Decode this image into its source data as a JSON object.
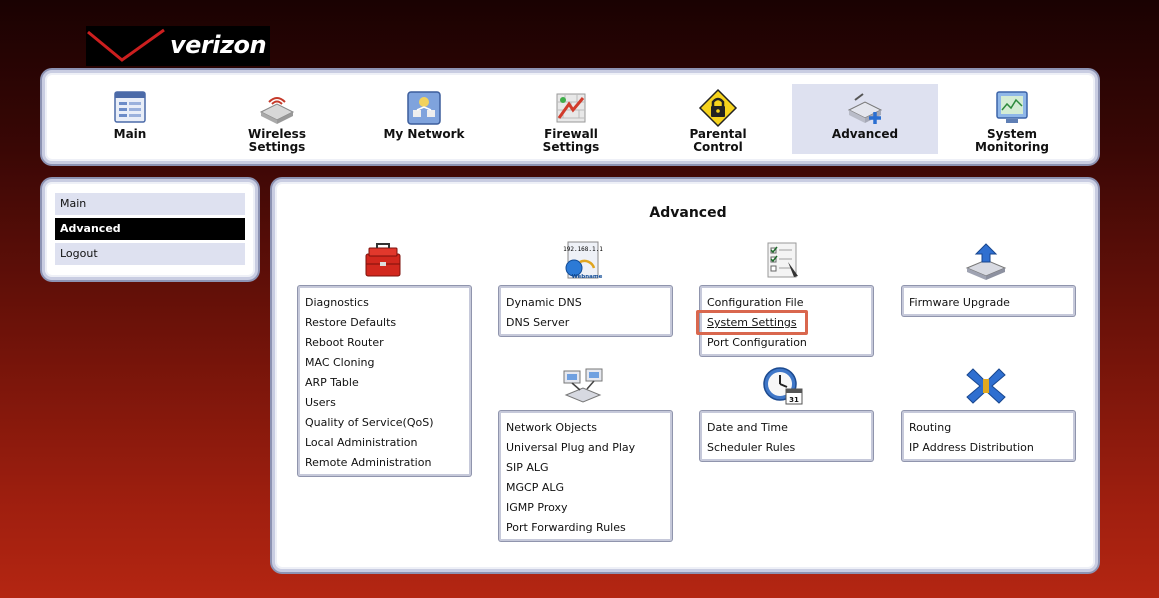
{
  "brand": {
    "name": "verizon",
    "accent_color": "#cc1f1f"
  },
  "topnav": {
    "items": [
      {
        "label": "Main",
        "icon": "main-icon"
      },
      {
        "label": "Wireless\nSettings",
        "icon": "wireless-router-icon"
      },
      {
        "label": "My Network",
        "icon": "my-network-icon"
      },
      {
        "label": "Firewall\nSettings",
        "icon": "firewall-icon"
      },
      {
        "label": "Parental\nControl",
        "icon": "parental-lock-icon"
      },
      {
        "label": "Advanced",
        "icon": "advanced-icon",
        "active": true
      },
      {
        "label": "System\nMonitoring",
        "icon": "system-monitoring-icon"
      }
    ]
  },
  "sidebar": {
    "items": [
      {
        "label": "Main"
      },
      {
        "label": "Advanced",
        "active": true
      },
      {
        "label": "Logout"
      }
    ]
  },
  "content": {
    "title": "Advanced",
    "groups": [
      {
        "icon": "toolbox-icon",
        "links": [
          "Diagnostics",
          "Restore Defaults",
          "Reboot Router",
          "MAC Cloning",
          "ARP Table",
          "Users",
          "Quality of Service(QoS)",
          "Local Administration",
          "Remote Administration"
        ]
      },
      {
        "icon": "dns-webname-icon",
        "icon_text": [
          "192.168.1.1",
          "Webname"
        ],
        "links": [
          "Dynamic DNS",
          "DNS Server"
        ]
      },
      {
        "icon": "configuration-checklist-icon",
        "links": [
          "Configuration File",
          "System Settings",
          "Port Configuration"
        ],
        "selected_index": 1
      },
      {
        "icon": "firmware-upgrade-icon",
        "links": [
          "Firmware Upgrade"
        ]
      },
      {
        "icon": "network-objects-icon",
        "links": [
          "Network Objects",
          "Universal Plug and Play",
          "SIP ALG",
          "MGCP ALG",
          "IGMP Proxy",
          "Port Forwarding Rules"
        ]
      },
      {
        "icon": "clock-calendar-icon",
        "icon_text": [
          "31"
        ],
        "links": [
          "Date and Time",
          "Scheduler Rules"
        ]
      },
      {
        "icon": "routing-icon",
        "links": [
          "Routing",
          "IP Address Distribution"
        ]
      }
    ]
  },
  "highlight_color": "#d9674e"
}
